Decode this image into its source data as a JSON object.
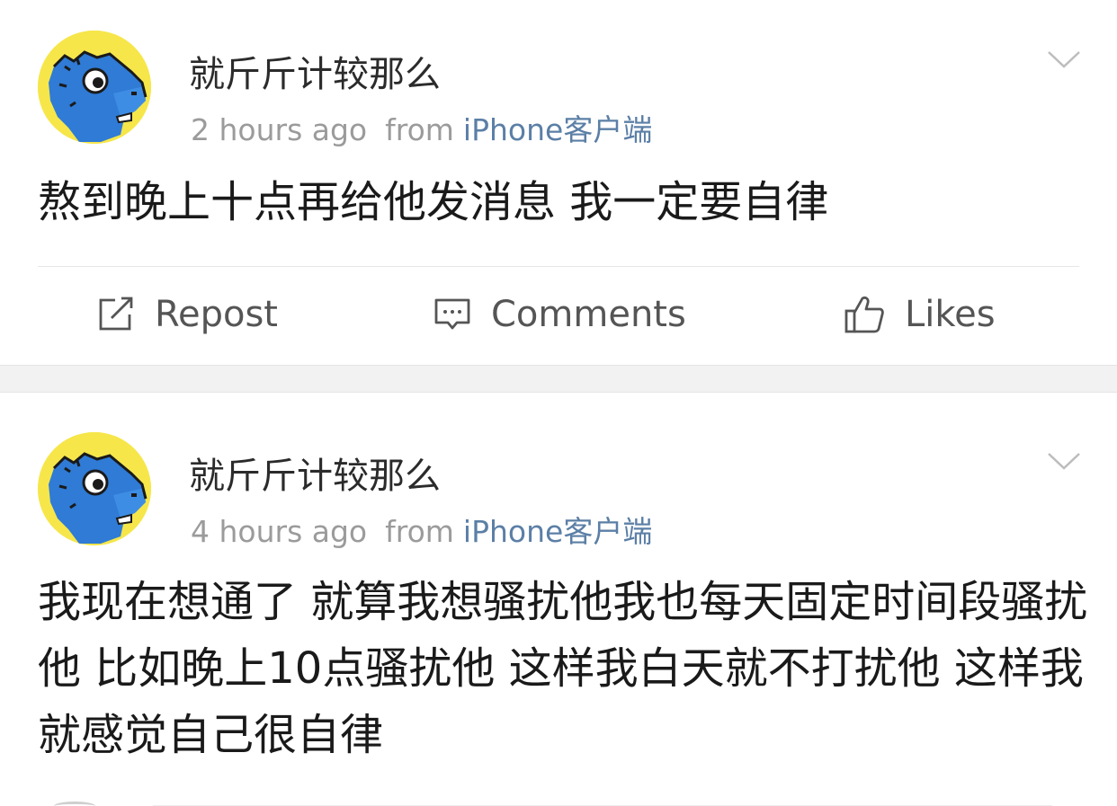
{
  "posts": [
    {
      "username": "就斤斤计较那么",
      "time": "2 hours ago",
      "from_label": "from",
      "source": "iPhone客户端",
      "content": "熬到晚上十点再给他发消息 我一定要自律",
      "actions": {
        "repost": "Repost",
        "comments": "Comments",
        "likes": "Likes"
      }
    },
    {
      "username": "就斤斤计较那么",
      "time": "4 hours ago",
      "from_label": "from",
      "source": "iPhone客户端",
      "content": "我现在想通了 就算我想骚扰他我也每天固定时间段骚扰他 比如晚上10点骚扰他 这样我白天就不打扰他 这样我就感觉自己很自律"
    }
  ],
  "icons": {
    "avatar": "blue-hippo-avatar",
    "menu": "chevron-down-icon",
    "repost": "repost-icon",
    "comments": "comment-icon",
    "likes": "thumbs-up-icon"
  },
  "colors": {
    "source_link": "#5b7fa6",
    "avatar_bg": "#f6e64a",
    "avatar_character": "#2f7bd6"
  }
}
